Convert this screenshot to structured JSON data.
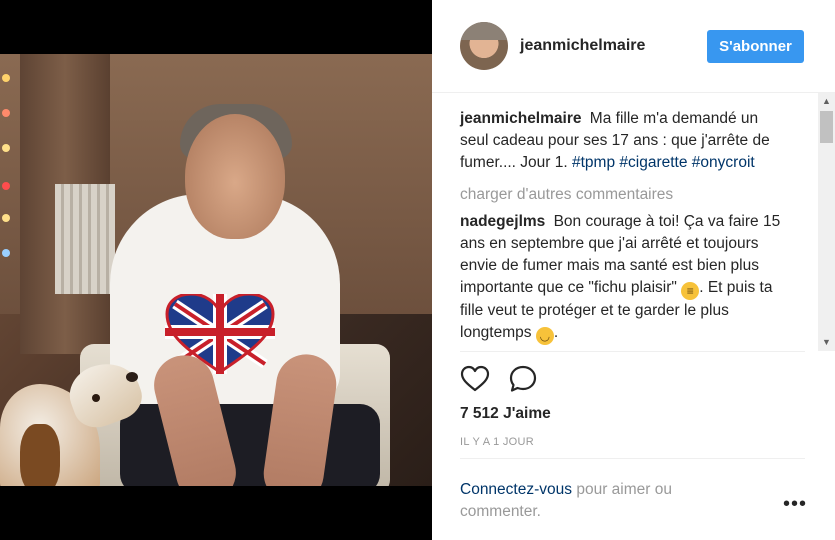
{
  "post": {
    "author": "jeanmichelmaire",
    "follow_label": "S'abonner",
    "caption_text": "Ma fille m'a demandé un seul cadeau pour ses 17 ans : que j'arrête de fumer.... Jour 1.",
    "hashtags": [
      "#tpmp",
      "#cigarette",
      "#onycroit"
    ],
    "load_more": "charger d'autres commentaires",
    "comments": [
      {
        "author": "nadegejlms",
        "text_1": "Bon courage à toi! Ça va faire 15 ans en septembre que j'ai arrêté et toujours envie de fumer mais ma santé est bien plus importante que ce \"fichu plaisir\"",
        "text_2": ". Et puis ta fille veut te protéger et te garder le plus longtemps",
        "text_3": "."
      }
    ],
    "likes": "7 512 J'aime",
    "timestamp": "IL Y A 1 JOUR",
    "login_link": "Connectez-vous",
    "login_rest": "pour aimer ou commenter.",
    "more_label": "•••"
  },
  "icons": {
    "like": "heart-outline-icon",
    "comment": "speech-bubble-icon",
    "emoji_grin": "grimacing-face-emoji",
    "emoji_smile": "smiling-face-emoji"
  },
  "colors": {
    "accent": "#3897f0",
    "hashtag": "#003569",
    "muted": "#999999",
    "text": "#262626"
  }
}
